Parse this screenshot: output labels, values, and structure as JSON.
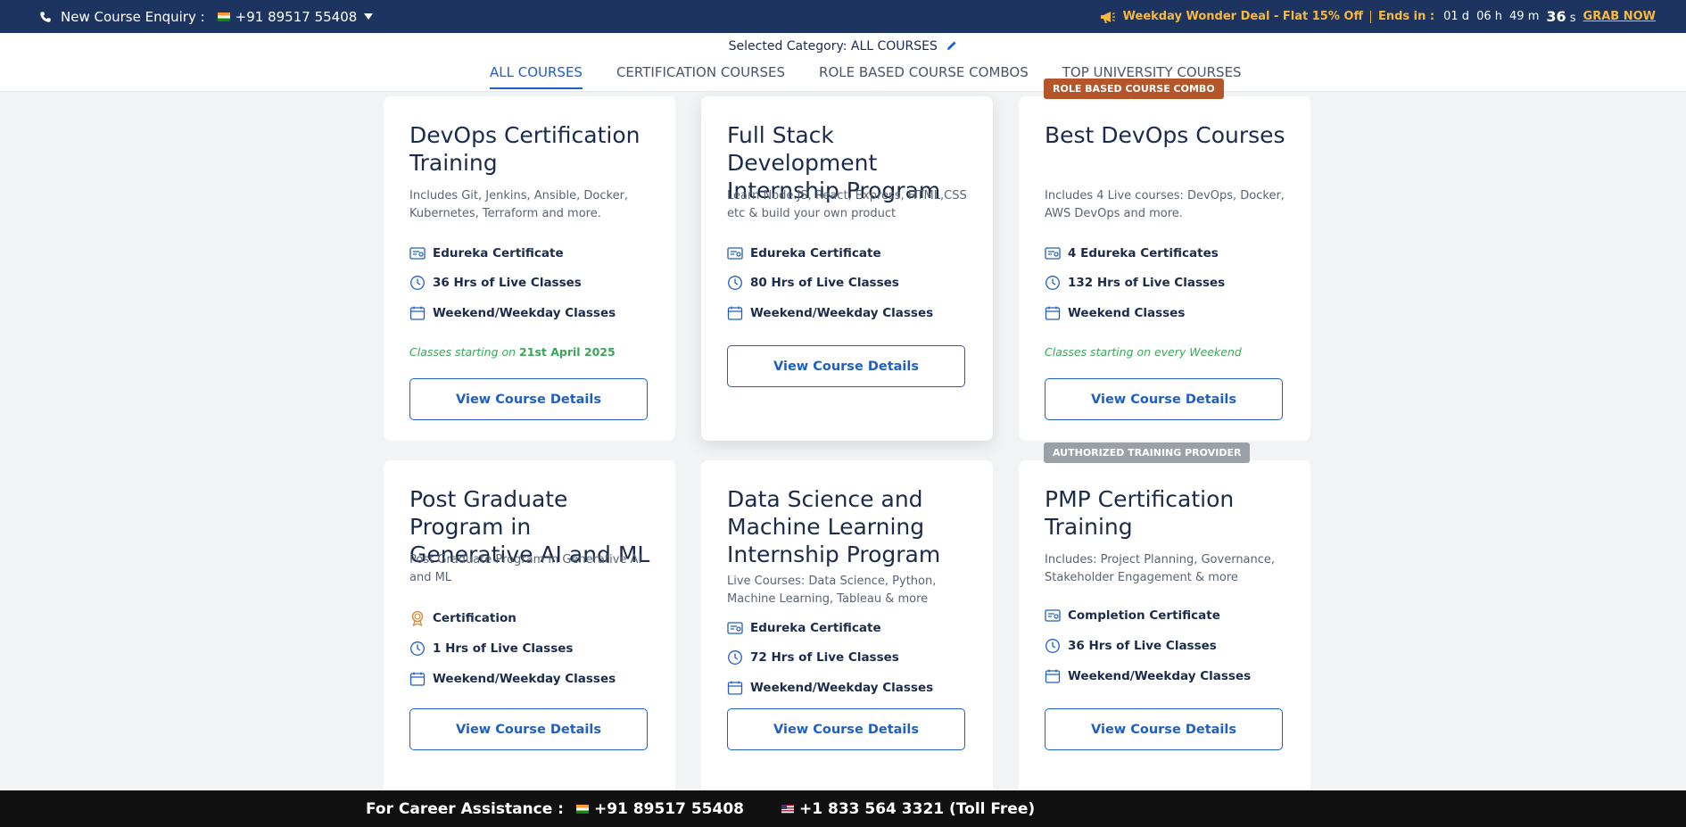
{
  "topbar": {
    "enquiry_label": "New Course Enquiry :",
    "phone": "+91 89517 55408",
    "deal": "Weekday Wonder Deal - Flat 15% Off",
    "ends_label": "Ends in :",
    "timer": {
      "d": "01",
      "d_unit": "d",
      "h": "06",
      "h_unit": "h",
      "m": "49",
      "m_unit": "m",
      "s": "36",
      "s_unit": "s"
    },
    "grab": "GRAB NOW"
  },
  "category": {
    "selected_label": "Selected Category: ALL COURSES",
    "tabs": [
      "ALL COURSES",
      "CERTIFICATION COURSES",
      "ROLE BASED COURSE COMBOS",
      "TOP UNIVERSITY COURSES"
    ]
  },
  "cards": [
    {
      "title": "DevOps Certification Training",
      "desc": "Includes Git, Jenkins, Ansible, Docker, Kubernetes, Terraform and more.",
      "features": [
        "Edureka Certificate",
        "36 Hrs of Live Classes",
        "Weekend/Weekday Classes"
      ],
      "start_prefix": "Classes starting on",
      "start_date": "21st April 2025",
      "button": "View Course Details"
    },
    {
      "title": "Full Stack Development Internship Program",
      "desc": "Learn Node.JS, React, Express, HTML,CSS etc & build your own product",
      "features": [
        "Edureka Certificate",
        "80 Hrs of Live Classes",
        "Weekend/Weekday Classes"
      ],
      "button": "View Course Details"
    },
    {
      "badge": "ROLE BASED COURSE COMBO",
      "title": "Best DevOps Courses",
      "desc": "Includes 4 Live courses: DevOps, Docker, AWS DevOps and more.",
      "features": [
        "4 Edureka Certificates",
        "132 Hrs of Live Classes",
        "Weekend Classes"
      ],
      "start_prefix": "Classes starting on every Weekend",
      "button": "View Course Details"
    },
    {
      "title": "Post Graduate Program in Generative AI and ML",
      "desc": "Post Graduate Program in Generative AI and ML",
      "features": [
        "Certification",
        "1 Hrs of Live Classes",
        "Weekend/Weekday Classes"
      ],
      "button": "View Course Details"
    },
    {
      "title": "Data Science and Machine Learning Internship Program",
      "desc": "Live Courses: Data Science, Python, Machine Learning, Tableau & more",
      "features": [
        "Edureka Certificate",
        "72 Hrs of Live Classes",
        "Weekend/Weekday Classes"
      ],
      "button": "View Course Details"
    },
    {
      "badge": "AUTHORIZED TRAINING PROVIDER",
      "title": "PMP Certification Training",
      "desc": "Includes: Project Planning, Governance, Stakeholder Engagement & more",
      "features": [
        "Completion Certificate",
        "36 Hrs of Live Classes",
        "Weekend/Weekday Classes"
      ],
      "button": "View Course Details"
    }
  ],
  "bottombar": {
    "label": "For Career Assistance :",
    "phone_in": "+91 89517 55408",
    "phone_us": "+1 833 564 3321 (Toll Free)"
  },
  "colors": {
    "navy": "#1d3461",
    "accent": "#1f5fc4",
    "deal": "#f6b93b",
    "green": "#3aa65a",
    "badge_orange": "#b4552a",
    "badge_grey": "#9aa0a6"
  }
}
